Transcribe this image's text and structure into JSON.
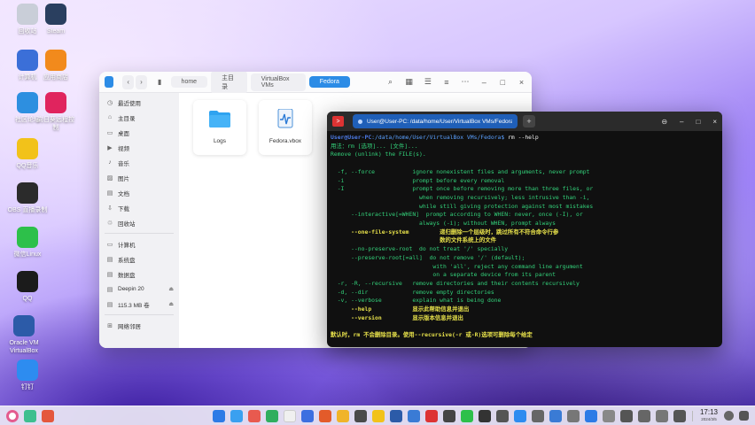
{
  "desktop": {
    "icons": [
      {
        "label": "回收站",
        "color": "#c9ced8"
      },
      {
        "label": "Steam",
        "color": "#2a3f5f"
      },
      {
        "label": "计算机",
        "color": "#3b6fd8"
      },
      {
        "label": "应用商店",
        "color": "#f28a1c"
      },
      {
        "label": "社区论坛",
        "color": "#2d8fe0"
      },
      {
        "label": "向日葵远程控制",
        "color": "#e0245e"
      },
      {
        "label": "QQ音乐",
        "color": "#f2c21a"
      },
      {
        "label": "OBS 直播录制",
        "color": "#2b2b2b"
      },
      {
        "label": "微信Linux",
        "color": "#2dc04a"
      },
      {
        "label": "QQ",
        "color": "#1b1b1b"
      },
      {
        "label": "Oracle VM VirtualBox",
        "color": "#2c5ba8"
      },
      {
        "label": "钉钉",
        "color": "#2d8cf0"
      }
    ]
  },
  "file_manager": {
    "breadcrumb": [
      "home",
      "主目录",
      "VirtualBox VMs",
      "Fedora"
    ],
    "sidebar": {
      "group1": [
        "最近使用",
        "主目录",
        "桌面",
        "视频",
        "音乐",
        "图片",
        "文档",
        "下载",
        "回收站"
      ],
      "group2": [
        "计算机",
        "系统盘",
        "数据盘",
        "Deepin 20",
        "115.3 MB 卷"
      ],
      "group3": [
        "网络邻居"
      ]
    },
    "files": [
      {
        "name": "Logs",
        "icon": "folder-icon"
      },
      {
        "name": "Fedora.vbox",
        "icon": "vbox-file-icon"
      }
    ]
  },
  "terminal": {
    "tab_title": "User@User-PC: /data/home/User/VirtualBox VMs/Fedora",
    "prompt_user": "User@User-PC",
    "prompt_path": ":/data/home/User/VirtualBox VMs/Fedora$",
    "command": " rm --help",
    "lines": [
      "用法：rm [选项]... [文件]...",
      "Remove (unlink) the FILE(s).",
      "",
      "  -f, --force           ignore nonexistent files and arguments, never prompt",
      "  -i                    prompt before every removal",
      "  -I                    prompt once before removing more than three files, or",
      "                          when removing recursively; less intrusive than -i,",
      "                          while still giving protection against most mistakes",
      "      --interactive[=WHEN]  prompt according to WHEN: never, once (-I), or",
      "                          always (-i); without WHEN, prompt always",
      "      --one-file-system         递归删除一个层级时，跳过所有不符合命令行参",
      "                                数的文件系统上的文件",
      "      --no-preserve-root  do not treat '/' specially",
      "      --preserve-root[=all]  do not remove '/' (default);",
      "                              with 'all', reject any command line argument",
      "                              on a separate device from its parent",
      "  -r, -R, --recursive   remove directories and their contents recursively",
      "  -d, --dir             remove empty directories",
      "  -v, --verbose         explain what is being done",
      "      --help            显示此帮助信息并退出",
      "      --version         显示版本信息并退出",
      "",
      "默认时，rm 不会删除目录。使用--recursive(-r 或-R)选项可删除每个给定"
    ]
  },
  "taskbar": {
    "time": "17:13",
    "date": "2024/3/5",
    "apps": [
      "#2d7be6",
      "#3aa0f0",
      "#e85a4f",
      "#2fae5e",
      "#f0f0f0",
      "#3d6fe0",
      "#e35b2a",
      "#f0b429",
      "#4a4a4a",
      "#f2c21a",
      "#2c5ba8",
      "#3a7bd5",
      "#d33",
      "#444",
      "#2dc04a",
      "#333",
      "#555",
      "#2d8cf0",
      "#666",
      "#3a7bd5",
      "#777",
      "#2d7be6",
      "#888",
      "#555",
      "#666",
      "#777",
      "#555"
    ]
  }
}
